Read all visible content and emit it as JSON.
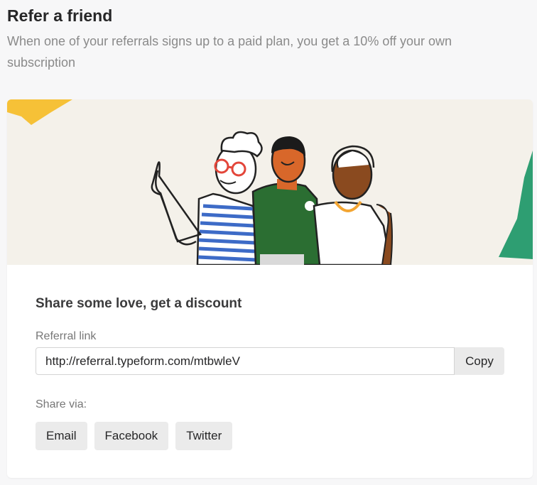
{
  "page": {
    "title": "Refer a friend",
    "subtitle": "When one of your referrals signs up to a paid plan, you get a 10% off your own subscription"
  },
  "card": {
    "heading": "Share some love, get a discount",
    "referral_label": "Referral link",
    "referral_value": "http://referral.typeform.com/mtbwleV",
    "copy_label": "Copy",
    "share_label": "Share via:",
    "share_buttons": [
      "Email",
      "Facebook",
      "Twitter"
    ]
  },
  "colors": {
    "hero_background": "#f4f1ea",
    "yellow_shape": "#f6c137",
    "green_shape": "#2e9e72",
    "shirt_green": "#2b6e32",
    "skin_orange": "#d8672a",
    "stripe_blue": "#3d6bc7"
  }
}
